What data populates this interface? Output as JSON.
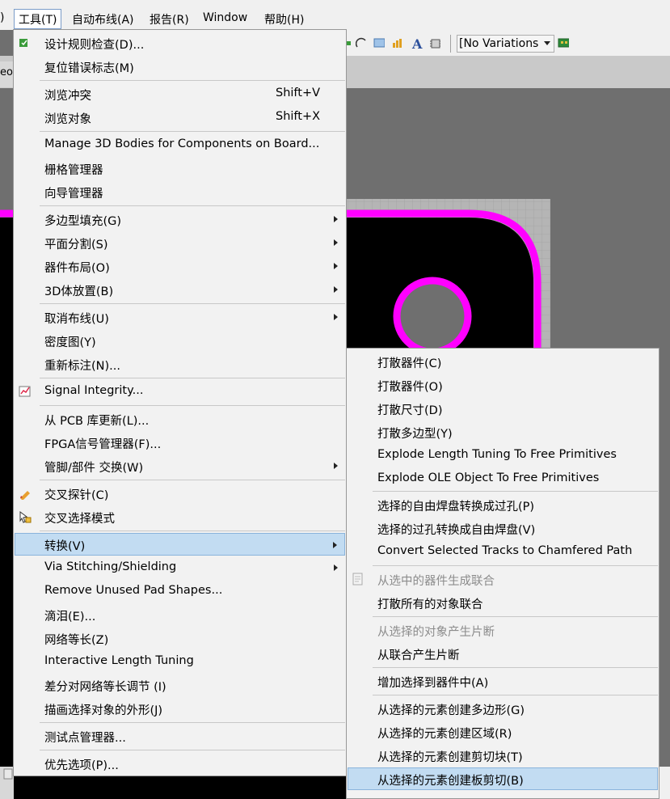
{
  "menubar": {
    "items": [
      {
        "label": ")"
      },
      {
        "label": "工具(T)"
      },
      {
        "label": "自动布线(A)"
      },
      {
        "label": "报告(R)"
      },
      {
        "label": "Window"
      },
      {
        "label": "帮助(H)"
      }
    ]
  },
  "toolbar": {
    "variations": "[No Variations"
  },
  "tab": {
    "stub": "eo"
  },
  "tools_menu": {
    "items": [
      {
        "label": "设计规则检查(D)...",
        "icon": "drc-icon"
      },
      {
        "label": "复位错误标志(M)"
      },
      {
        "label": "浏览冲突",
        "shortcut": "Shift+V"
      },
      {
        "label": "浏览对象",
        "shortcut": "Shift+X"
      },
      {
        "label": "Manage 3D Bodies for Components on Board..."
      },
      {
        "label": "栅格管理器"
      },
      {
        "label": "向导管理器"
      },
      {
        "label": "多边型填充(G)",
        "submenu": true
      },
      {
        "label": "平面分割(S)",
        "submenu": true
      },
      {
        "label": "器件布局(O)",
        "submenu": true
      },
      {
        "label": "3D体放置(B)",
        "submenu": true
      },
      {
        "label": "取消布线(U)",
        "submenu": true
      },
      {
        "label": "密度图(Y)"
      },
      {
        "label": "重新标注(N)..."
      },
      {
        "label": "Signal Integrity...",
        "icon": "signal-integrity-icon"
      },
      {
        "label": "从 PCB 库更新(L)..."
      },
      {
        "label": "FPGA信号管理器(F)..."
      },
      {
        "label": "管脚/部件 交换(W)",
        "submenu": true
      },
      {
        "label": "交叉探针(C)",
        "icon": "cross-probe-icon"
      },
      {
        "label": "交叉选择模式",
        "icon": "cross-select-icon"
      },
      {
        "label": "转换(V)",
        "submenu": true,
        "highlighted": true
      },
      {
        "label": "Via Stitching/Shielding",
        "submenu": true
      },
      {
        "label": "Remove Unused Pad Shapes..."
      },
      {
        "label": "滴泪(E)..."
      },
      {
        "label": "网络等长(Z)"
      },
      {
        "label": "Interactive Length Tuning"
      },
      {
        "label": "差分对网络等长调节 (I)"
      },
      {
        "label": "描画选择对象的外形(J)"
      },
      {
        "label": "测试点管理器..."
      },
      {
        "label": "优先选项(P)..."
      }
    ]
  },
  "convert_menu": {
    "items": [
      {
        "label": "打散器件(C)"
      },
      {
        "label": "打散器件(O)"
      },
      {
        "label": "打散尺寸(D)"
      },
      {
        "label": "打散多边型(Y)"
      },
      {
        "label": "Explode Length Tuning To Free Primitives"
      },
      {
        "label": "Explode OLE Object To Free Primitives"
      },
      {
        "label": "选择的自由焊盘转换成过孔(P)"
      },
      {
        "label": "选择的过孔转换成自由焊盘(V)"
      },
      {
        "label": "Convert Selected Tracks to Chamfered Path"
      },
      {
        "label": "从选中的器件生成联合",
        "disabled": true,
        "icon": "union-icon"
      },
      {
        "label": "打散所有的对象联合"
      },
      {
        "label": "从选择的对象产生片断",
        "disabled": true
      },
      {
        "label": "从联合产生片断"
      },
      {
        "label": "增加选择到器件中(A)"
      },
      {
        "label": "从选择的元素创建多边形(G)"
      },
      {
        "label": "从选择的元素创建区域(R)"
      },
      {
        "label": "从选择的元素创建剪切块(T)"
      },
      {
        "label": "从选择的元素创建板剪切(B)",
        "highlighted": true
      }
    ]
  },
  "colors": {
    "highlight": "#c2dcf2",
    "board_outline": "#ff00ff",
    "board": "#000000"
  }
}
